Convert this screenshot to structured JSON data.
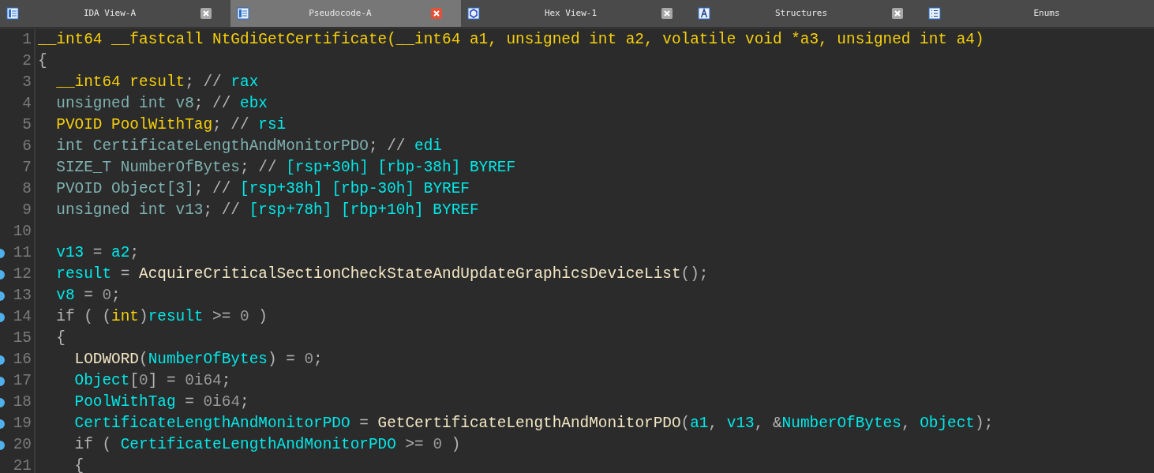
{
  "tabs": [
    {
      "label": "IDA View-A",
      "selected": false,
      "kind": "listing",
      "closable": true
    },
    {
      "label": "Pseudocode-A",
      "selected": true,
      "kind": "listing",
      "closable": true
    },
    {
      "label": "Hex View-1",
      "selected": false,
      "kind": "hexagon",
      "closable": true
    },
    {
      "label": "Structures",
      "selected": false,
      "kind": "struct",
      "closable": true
    },
    {
      "label": "Enums",
      "selected": false,
      "kind": "enum",
      "closable": false
    }
  ],
  "lines": [
    {
      "number": "1",
      "breakpoint": false,
      "tokens": [
        {
          "kind": "k",
          "text": "__int64 __fastcall NtGdiGetCertificate(__int64 a1, unsigned int a2, volatile void *a3, unsigned int a4)"
        }
      ]
    },
    {
      "number": "2",
      "breakpoint": false,
      "tokens": [
        {
          "kind": "p",
          "text": "{"
        }
      ]
    },
    {
      "number": "3",
      "breakpoint": false,
      "tokens": [
        {
          "kind": "k",
          "text": "  __int64 result"
        },
        {
          "kind": "p",
          "text": "; // "
        },
        {
          "kind": "v",
          "text": "rax"
        }
      ]
    },
    {
      "number": "4",
      "breakpoint": false,
      "tokens": [
        {
          "kind": "t",
          "text": "  unsigned int v8"
        },
        {
          "kind": "p",
          "text": "; // "
        },
        {
          "kind": "v",
          "text": "ebx"
        }
      ]
    },
    {
      "number": "5",
      "breakpoint": false,
      "tokens": [
        {
          "kind": "k",
          "text": "  PVOID PoolWithTag"
        },
        {
          "kind": "p",
          "text": "; // "
        },
        {
          "kind": "v",
          "text": "rsi"
        }
      ]
    },
    {
      "number": "6",
      "breakpoint": false,
      "tokens": [
        {
          "kind": "t",
          "text": "  int CertificateLengthAndMonitorPDO"
        },
        {
          "kind": "p",
          "text": "; // "
        },
        {
          "kind": "v",
          "text": "edi"
        }
      ]
    },
    {
      "number": "7",
      "breakpoint": false,
      "tokens": [
        {
          "kind": "t",
          "text": "  SIZE_T NumberOfBytes"
        },
        {
          "kind": "p",
          "text": "; // "
        },
        {
          "kind": "v",
          "text": "[rsp+30h] [rbp-38h] BYREF"
        }
      ]
    },
    {
      "number": "8",
      "breakpoint": false,
      "tokens": [
        {
          "kind": "t",
          "text": "  PVOID Object[3]"
        },
        {
          "kind": "p",
          "text": "; // "
        },
        {
          "kind": "v",
          "text": "[rsp+38h] [rbp-30h] BYREF"
        }
      ]
    },
    {
      "number": "9",
      "breakpoint": false,
      "tokens": [
        {
          "kind": "t",
          "text": "  unsigned int v13"
        },
        {
          "kind": "p",
          "text": "; // "
        },
        {
          "kind": "v",
          "text": "[rsp+78h] [rbp+10h] BYREF"
        }
      ]
    },
    {
      "number": "10",
      "breakpoint": false
    },
    {
      "number": "11",
      "breakpoint": true,
      "tokens": [
        {
          "kind": "v",
          "text": "  v13"
        },
        {
          "kind": "p",
          "text": " = "
        },
        {
          "kind": "v",
          "text": "a2"
        },
        {
          "kind": "p",
          "text": ";"
        }
      ]
    },
    {
      "number": "12",
      "breakpoint": true,
      "tokens": [
        {
          "kind": "v",
          "text": "  result"
        },
        {
          "kind": "p",
          "text": " = "
        },
        {
          "kind": "f",
          "text": "AcquireCriticalSectionCheckStateAndUpdateGraphicsDeviceList"
        },
        {
          "kind": "p",
          "text": "();"
        }
      ]
    },
    {
      "number": "13",
      "breakpoint": true,
      "tokens": [
        {
          "kind": "v",
          "text": "  v8"
        },
        {
          "kind": "p",
          "text": " = "
        },
        {
          "kind": "n",
          "text": "0"
        },
        {
          "kind": "p",
          "text": ";"
        }
      ]
    },
    {
      "number": "14",
      "breakpoint": true,
      "tokens": [
        {
          "kind": "p",
          "text": "  if ( ("
        },
        {
          "kind": "k",
          "text": "int"
        },
        {
          "kind": "p",
          "text": ")"
        },
        {
          "kind": "v",
          "text": "result"
        },
        {
          "kind": "p",
          "text": " >= "
        },
        {
          "kind": "n",
          "text": "0"
        },
        {
          "kind": "p",
          "text": " )"
        }
      ]
    },
    {
      "number": "15",
      "breakpoint": false,
      "tokens": [
        {
          "kind": "p",
          "text": "  {"
        }
      ]
    },
    {
      "number": "16",
      "breakpoint": true,
      "tokens": [
        {
          "kind": "f",
          "text": "    LODWORD"
        },
        {
          "kind": "p",
          "text": "("
        },
        {
          "kind": "v",
          "text": "NumberOfBytes"
        },
        {
          "kind": "p",
          "text": ") = "
        },
        {
          "kind": "n",
          "text": "0"
        },
        {
          "kind": "p",
          "text": ";"
        }
      ]
    },
    {
      "number": "17",
      "breakpoint": true,
      "tokens": [
        {
          "kind": "v",
          "text": "    Object"
        },
        {
          "kind": "p",
          "text": "["
        },
        {
          "kind": "n",
          "text": "0"
        },
        {
          "kind": "p",
          "text": "] = "
        },
        {
          "kind": "n",
          "text": "0i64"
        },
        {
          "kind": "p",
          "text": ";"
        }
      ]
    },
    {
      "number": "18",
      "breakpoint": true,
      "tokens": [
        {
          "kind": "v",
          "text": "    PoolWithTag"
        },
        {
          "kind": "p",
          "text": " = "
        },
        {
          "kind": "n",
          "text": "0i64"
        },
        {
          "kind": "p",
          "text": ";"
        }
      ]
    },
    {
      "number": "19",
      "breakpoint": true,
      "tokens": [
        {
          "kind": "v",
          "text": "    CertificateLengthAndMonitorPDO"
        },
        {
          "kind": "p",
          "text": " = "
        },
        {
          "kind": "f",
          "text": "GetCertificateLengthAndMonitorPDO"
        },
        {
          "kind": "p",
          "text": "("
        },
        {
          "kind": "v",
          "text": "a1"
        },
        {
          "kind": "p",
          "text": ", "
        },
        {
          "kind": "v",
          "text": "v13"
        },
        {
          "kind": "p",
          "text": ", &"
        },
        {
          "kind": "v",
          "text": "NumberOfBytes"
        },
        {
          "kind": "p",
          "text": ", "
        },
        {
          "kind": "v",
          "text": "Object"
        },
        {
          "kind": "p",
          "text": ");"
        }
      ]
    },
    {
      "number": "20",
      "breakpoint": true,
      "tokens": [
        {
          "kind": "p",
          "text": "    if ( "
        },
        {
          "kind": "v",
          "text": "CertificateLengthAndMonitorPDO"
        },
        {
          "kind": "p",
          "text": " >= "
        },
        {
          "kind": "n",
          "text": "0"
        },
        {
          "kind": "p",
          "text": " )"
        }
      ]
    },
    {
      "number": "21",
      "breakpoint": false,
      "tokens": [
        {
          "kind": "p",
          "text": "    {"
        }
      ]
    }
  ]
}
